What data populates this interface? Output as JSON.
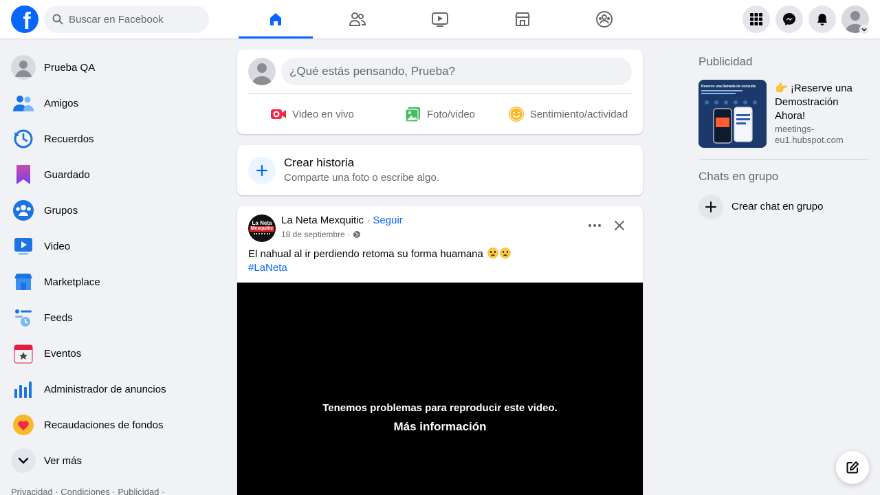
{
  "topbar": {
    "logo_letter": "f",
    "search_placeholder": "Buscar en Facebook",
    "nav_tabs": [
      "home-icon",
      "friends-icon",
      "watch-icon",
      "marketplace-icon",
      "groups-icon"
    ],
    "active_tab": "home-icon"
  },
  "sidebar": {
    "items": [
      {
        "label": "Prueba QA",
        "icon": "profile-avatar"
      },
      {
        "label": "Amigos",
        "icon": "friends-icon"
      },
      {
        "label": "Recuerdos",
        "icon": "memories-icon"
      },
      {
        "label": "Guardado",
        "icon": "saved-icon"
      },
      {
        "label": "Grupos",
        "icon": "groups-icon"
      },
      {
        "label": "Video",
        "icon": "video-icon"
      },
      {
        "label": "Marketplace",
        "icon": "marketplace-icon"
      },
      {
        "label": "Feeds",
        "icon": "feeds-icon"
      },
      {
        "label": "Eventos",
        "icon": "events-icon"
      },
      {
        "label": "Administrador de anuncios",
        "icon": "ads-manager-icon"
      },
      {
        "label": "Recaudaciones de fondos",
        "icon": "fundraisers-icon"
      },
      {
        "label": "Ver más",
        "icon": "chevron-down-icon"
      }
    ],
    "footer": "Privacidad · Condiciones · Publicidad ·"
  },
  "composer": {
    "placeholder": "¿Qué estás pensando, Prueba?",
    "actions": {
      "live": "Video en vivo",
      "photo": "Foto/video",
      "feeling": "Sentimiento/actividad"
    }
  },
  "story": {
    "title": "Crear historia",
    "subtitle": "Comparte una foto o escribe algo."
  },
  "post": {
    "author": "La Neta Mexquitic",
    "separator": "·",
    "follow": "Seguir",
    "date": "18 de septiembre ·",
    "text": "El nahual al ir perdiendo retoma su forma huamana",
    "hashtag": "#LaNeta",
    "avatar_line1": "La Neta",
    "avatar_line2": "Mexquitic",
    "video_error": "Tenemos problemas para reproducir este video.",
    "video_more": "Más información"
  },
  "right": {
    "ads_heading": "Publicidad",
    "ad_title": "👉 ¡Reserve una Demostración Ahora!",
    "ad_url": "meetings-eu1.hubspot.com",
    "ad_image_caption": "Reserve una llamada de consulta",
    "chats_heading": "Chats en grupo",
    "create_chat": "Crear chat en grupo"
  },
  "colors": {
    "brand": "#0866ff",
    "background": "#f0f2f5",
    "secondary_text": "#65676b"
  }
}
